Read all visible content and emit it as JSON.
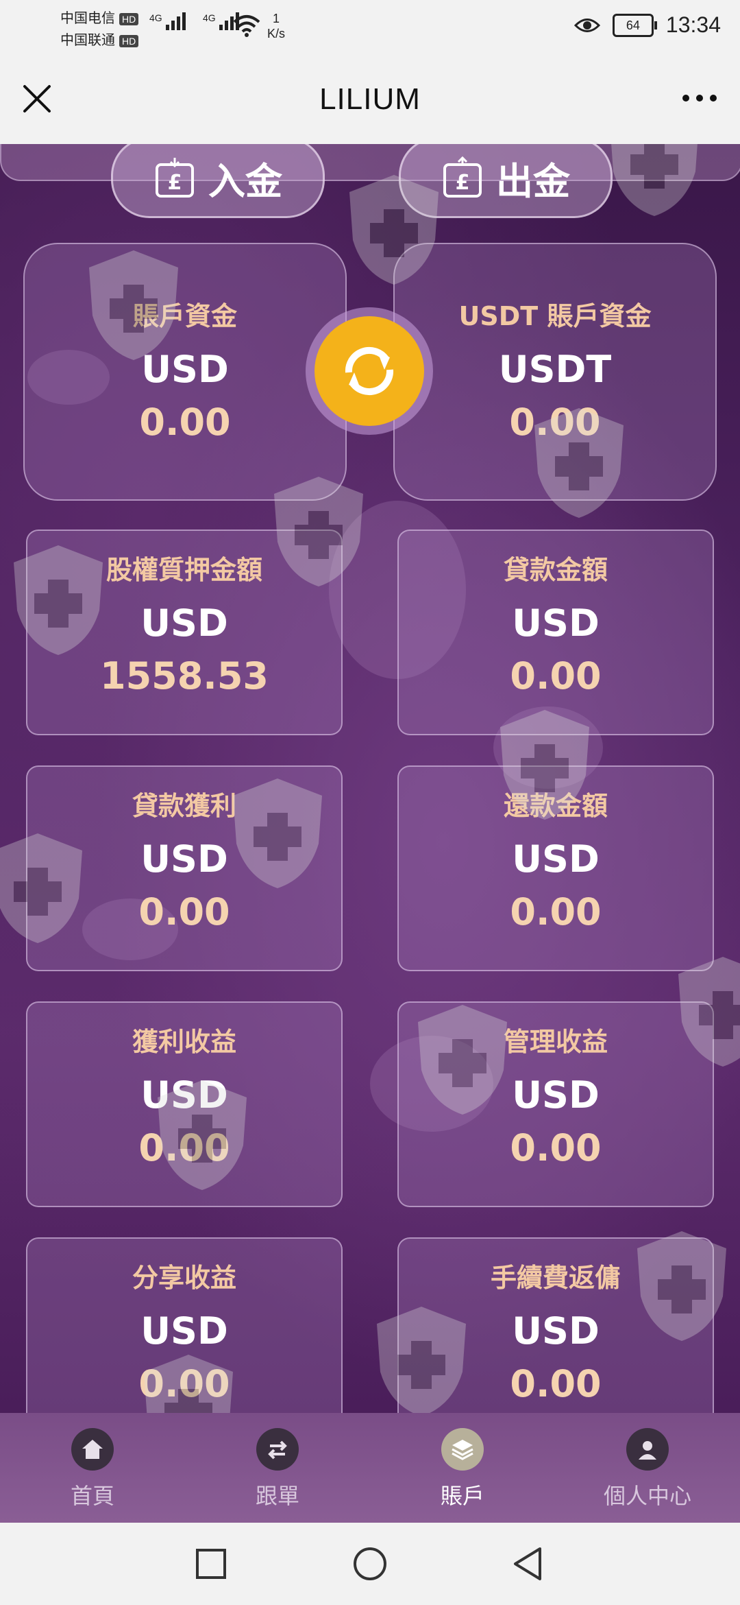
{
  "status_bar": {
    "carrier1": "中国电信",
    "carrier2": "中国联通",
    "hd_badge": "HD",
    "network": "4G",
    "speed_value": "1",
    "speed_unit": "K/s",
    "battery": "64",
    "time": "13:34"
  },
  "header": {
    "title": "LILIUM"
  },
  "actions": {
    "deposit": "入金",
    "withdraw": "出金"
  },
  "main_cards": [
    {
      "label": "賬戶資金",
      "currency": "USD",
      "amount": "0.00"
    },
    {
      "label": "USDT 賬戶資金",
      "currency": "USDT",
      "amount": "0.00"
    }
  ],
  "cards": [
    {
      "label": "股權質押金額",
      "currency": "USD",
      "amount": "1558.53"
    },
    {
      "label": "貸款金額",
      "currency": "USD",
      "amount": "0.00"
    },
    {
      "label": "貸款獲利",
      "currency": "USD",
      "amount": "0.00"
    },
    {
      "label": "還款金額",
      "currency": "USD",
      "amount": "0.00"
    },
    {
      "label": "獲利收益",
      "currency": "USD",
      "amount": "0.00"
    },
    {
      "label": "管理收益",
      "currency": "USD",
      "amount": "0.00"
    },
    {
      "label": "分享收益",
      "currency": "USD",
      "amount": "0.00"
    },
    {
      "label": "手續費返傭",
      "currency": "USD",
      "amount": "0.00"
    }
  ],
  "nav": [
    {
      "label": "首頁",
      "icon": "home-icon"
    },
    {
      "label": "跟單",
      "icon": "swap-icon"
    },
    {
      "label": "賬戶",
      "icon": "layers-icon",
      "active": true
    },
    {
      "label": "個人中心",
      "icon": "user-icon"
    }
  ],
  "colors": {
    "label": "#f3c9a3",
    "amount": "#f5d3b0",
    "swap": "#f4b21a",
    "bg": "#4e2360"
  }
}
